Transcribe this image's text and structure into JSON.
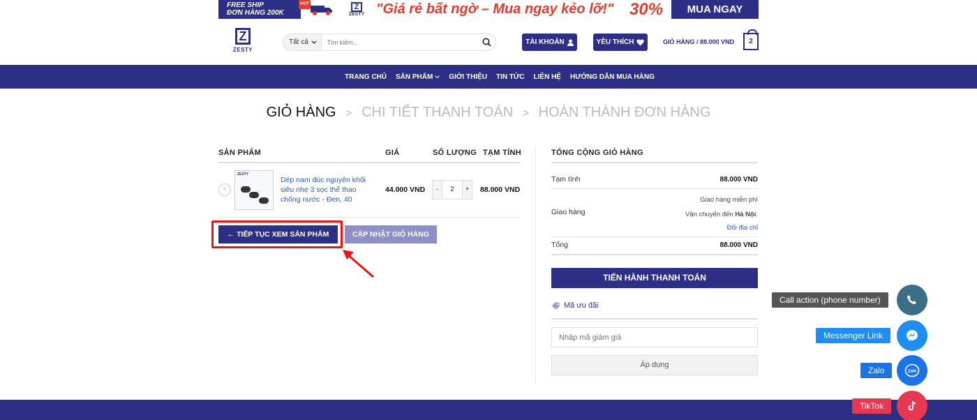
{
  "promo": {
    "left_line1": "FREE SHIP",
    "left_line2": "ĐƠN HÀNG 200K",
    "hot": "HOT",
    "logo_text": "ZESTY",
    "slogan": "\"Giá rẻ bất ngờ – Mua ngay kẻo lỡ!\"",
    "percent": "30%",
    "cta": "MUA NGAY"
  },
  "header": {
    "logo_text": "ZESTY",
    "search_category": "Tất cả",
    "search_placeholder": "Tìm kiếm...",
    "account_label": "TÀI KHOẢN",
    "wishlist_label": "YÊU THÍCH",
    "cart_label": "GIỎ HÀNG / 88.000 VND",
    "cart_count": "2"
  },
  "nav": {
    "items": [
      "TRANG CHỦ",
      "SẢN PHẨM",
      "GIỚI THIỆU",
      "TIN TỨC",
      "LIÊN HỆ",
      "HƯỚNG DẪN MUA HÀNG"
    ]
  },
  "steps": {
    "step1": "GIỎ HÀNG",
    "step2": "CHI TIẾT THANH TOÁN",
    "step3": "HOÀN THÀNH ĐƠN HÀNG",
    "separator": ">"
  },
  "cart": {
    "headers": {
      "product": "SẢN PHẨM",
      "price": "GIÁ",
      "qty": "SỐ LƯỢNG",
      "subtotal": "TẠM TÍNH"
    },
    "item": {
      "thumb_brand": "ZESTY",
      "name": "Dép nam đúc nguyên khối siêu nhẹ 3 sọc thể thao chống nước - Đen, 40",
      "price": "44.000 VND",
      "qty": "2",
      "subtotal": "88.000 VND",
      "remove": "×"
    },
    "continue_button": "← TIẾP TỤC XEM SẢN PHẨM",
    "update_button": "CẬP NHẬT GIỎ HÀNG"
  },
  "totals": {
    "title": "TỔNG CỘNG GIỎ HÀNG",
    "subtotal_label": "Tạm tính",
    "subtotal_value": "88.000 VND",
    "shipping_label": "Giao hàng",
    "shipping_line1": "Giao hàng miễn phí",
    "shipping_line2_prefix": "Vận chuyển đến",
    "shipping_city": "Hà Nội",
    "shipping_change": "Đổi địa chỉ",
    "total_label": "Tổng",
    "total_value": "88.000 VND",
    "checkout_button": "TIẾN HÀNH THANH TOÁN",
    "coupon_heading": "Mã ưu đãi",
    "coupon_placeholder": "Nhập mã giảm giá",
    "apply_button": "Áp dụng"
  },
  "floating": {
    "call_label": "Call action (phone number)",
    "messenger_label": "Messenger Link",
    "zalo_label": "Zalo",
    "zalo_icon_text": "Zalo",
    "tiktok_label": "TikTok"
  },
  "colors": {
    "brand": "#2d2f86",
    "accent_red": "#e63a2e",
    "link": "#2d5bb5",
    "call": "#3a6f87",
    "messenger": "#1e8df5",
    "zalo": "#1b73e8",
    "tiktok": "#e63850"
  }
}
